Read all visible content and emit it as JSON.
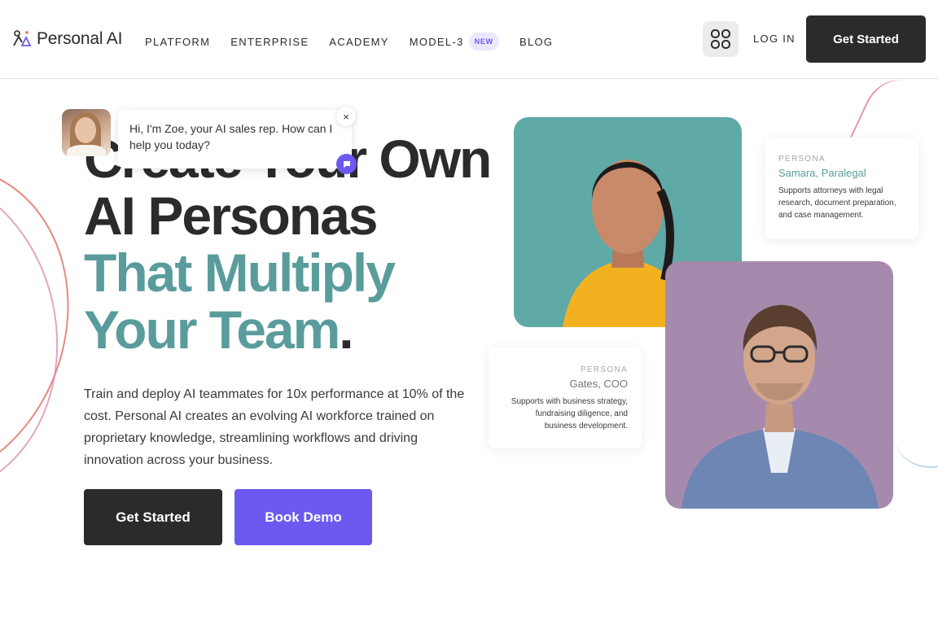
{
  "header": {
    "logo_text": "Personal AI",
    "nav": [
      {
        "label": "PLATFORM"
      },
      {
        "label": "ENTERPRISE"
      },
      {
        "label": "ACADEMY"
      },
      {
        "label": "MODEL-3",
        "badge": "NEW"
      },
      {
        "label": "BLOG"
      }
    ],
    "apps_icon": "grid-icon",
    "login_label": "LOG IN",
    "cta_label": "Get Started"
  },
  "hero": {
    "line1": "Create Your Own",
    "line2": "AI Personas",
    "line3": "That Multiply",
    "line4": "Your Team",
    "line4_suffix": ".",
    "description": "Train and deploy AI teammates for 10x performance at 10% of the cost. Personal AI creates an evolving AI workforce trained on proprietary knowledge, streamlining workflows and driving innovation across your business.",
    "primary_button": "Get Started",
    "secondary_button": "Book Demo"
  },
  "chat": {
    "message": "Hi, I'm Zoe, your AI sales rep. How can I help you today?",
    "close_glyph": "×"
  },
  "personas": [
    {
      "label": "PERSONA",
      "name": "Samara, Paralegal",
      "description": "Supports attorneys with legal research, document preparation, and case management."
    },
    {
      "label": "PERSONA",
      "name": "Gates, COO",
      "description": "Supports with business strategy, fundraising diligence, and business development."
    }
  ],
  "colors": {
    "dark": "#2b2b2e",
    "teal": "#5a9c9c",
    "purple": "#6c5af0"
  }
}
